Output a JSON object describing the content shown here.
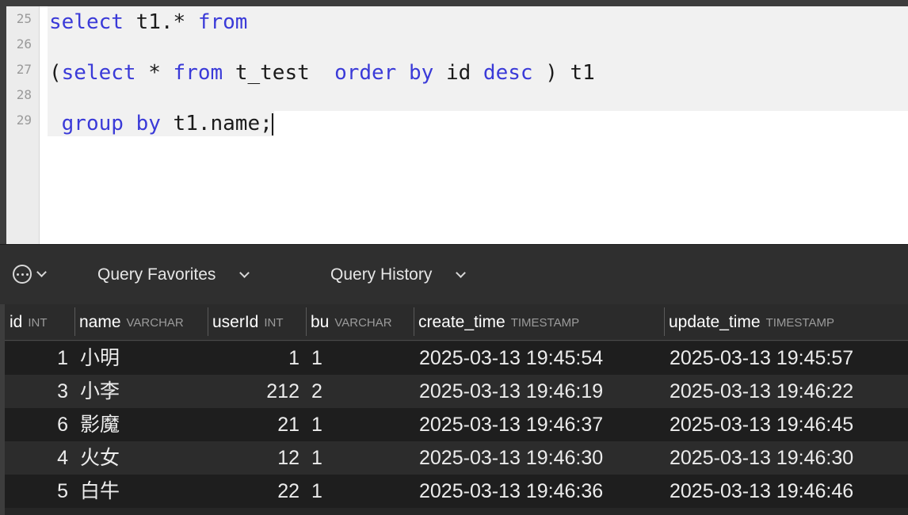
{
  "editor": {
    "line_numbers": [
      "25",
      "26",
      "27",
      "28",
      "29"
    ],
    "lines": [
      [
        {
          "t": "select",
          "k": true
        },
        {
          "t": " t1.* ",
          "k": false
        },
        {
          "t": "from",
          "k": true
        }
      ],
      [
        {
          "t": "(",
          "k": false
        },
        {
          "t": "select",
          "k": true
        },
        {
          "t": " * ",
          "k": false
        },
        {
          "t": "from",
          "k": true
        },
        {
          "t": " t_test  ",
          "k": false
        },
        {
          "t": "order by",
          "k": true
        },
        {
          "t": " id ",
          "k": false
        },
        {
          "t": "desc",
          "k": true
        },
        {
          "t": " ) t1",
          "k": false
        }
      ],
      [
        {
          "t": " ",
          "k": false
        },
        {
          "t": "group by",
          "k": true
        },
        {
          "t": " t1.name;",
          "k": false
        }
      ]
    ],
    "keyword_color": "#3a3ad8"
  },
  "toolbar": {
    "more_icon": "ellipsis-circle-icon",
    "favorites_label": "Query Favorites",
    "history_label": "Query History"
  },
  "grid": {
    "columns": [
      {
        "name": "id",
        "type": "INT"
      },
      {
        "name": "name",
        "type": "VARCHAR"
      },
      {
        "name": "userId",
        "type": "INT"
      },
      {
        "name": "bu",
        "type": "VARCHAR"
      },
      {
        "name": "create_time",
        "type": "TIMESTAMP"
      },
      {
        "name": "update_time",
        "type": "TIMESTAMP"
      }
    ],
    "rows": [
      [
        "1",
        "小明",
        "1",
        "1",
        "2025-03-13 19:45:54",
        "2025-03-13 19:45:57"
      ],
      [
        "3",
        "小李",
        "212",
        "2",
        "2025-03-13 19:46:19",
        "2025-03-13 19:46:22"
      ],
      [
        "6",
        "影魔",
        "21",
        "1",
        "2025-03-13 19:46:37",
        "2025-03-13 19:46:45"
      ],
      [
        "4",
        "火女",
        "12",
        "1",
        "2025-03-13 19:46:30",
        "2025-03-13 19:46:30"
      ],
      [
        "5",
        "白牛",
        "22",
        "1",
        "2025-03-13 19:46:36",
        "2025-03-13 19:46:46"
      ]
    ]
  }
}
